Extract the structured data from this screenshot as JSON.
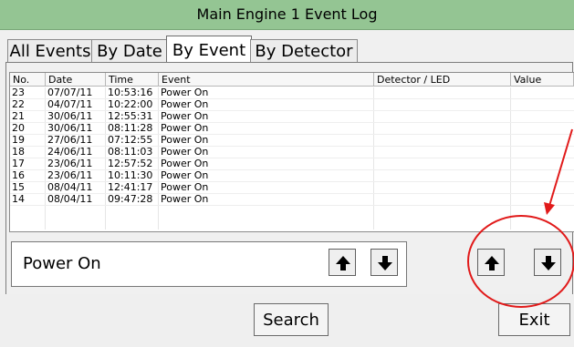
{
  "window": {
    "title": "Main Engine 1 Event Log"
  },
  "tabs": [
    {
      "label": "All Events"
    },
    {
      "label": "By Date"
    },
    {
      "label": "By Event",
      "active": true
    },
    {
      "label": "By Detector"
    }
  ],
  "table": {
    "headers": [
      "No.",
      "Date",
      "Time",
      "Event",
      "Detector / LED",
      "Value"
    ],
    "rows": [
      {
        "no": "23",
        "date": "07/07/11",
        "time": "10:53:16",
        "event": "Power On"
      },
      {
        "no": "22",
        "date": "04/07/11",
        "time": "10:22:00",
        "event": "Power On"
      },
      {
        "no": "21",
        "date": "30/06/11",
        "time": "12:55:31",
        "event": "Power On"
      },
      {
        "no": "20",
        "date": "30/06/11",
        "time": "08:11:28",
        "event": "Power On"
      },
      {
        "no": "19",
        "date": "27/06/11",
        "time": "07:12:55",
        "event": "Power On"
      },
      {
        "no": "18",
        "date": "24/06/11",
        "time": "08:11:03",
        "event": "Power On"
      },
      {
        "no": "17",
        "date": "23/06/11",
        "time": "12:57:52",
        "event": "Power On"
      },
      {
        "no": "16",
        "date": "23/06/11",
        "time": "10:11:30",
        "event": "Power On"
      },
      {
        "no": "15",
        "date": "08/04/11",
        "time": "12:41:17",
        "event": "Power On"
      },
      {
        "no": "14",
        "date": "08/04/11",
        "time": "09:47:28",
        "event": "Power On"
      }
    ]
  },
  "event_selector": {
    "value": "Power On"
  },
  "buttons": {
    "search": "Search",
    "exit": "Exit"
  },
  "icons": {
    "up": "arrow-up-icon",
    "down": "arrow-down-icon"
  },
  "colors": {
    "title_bar": "#94c593",
    "annotation": "#e11a1a"
  }
}
